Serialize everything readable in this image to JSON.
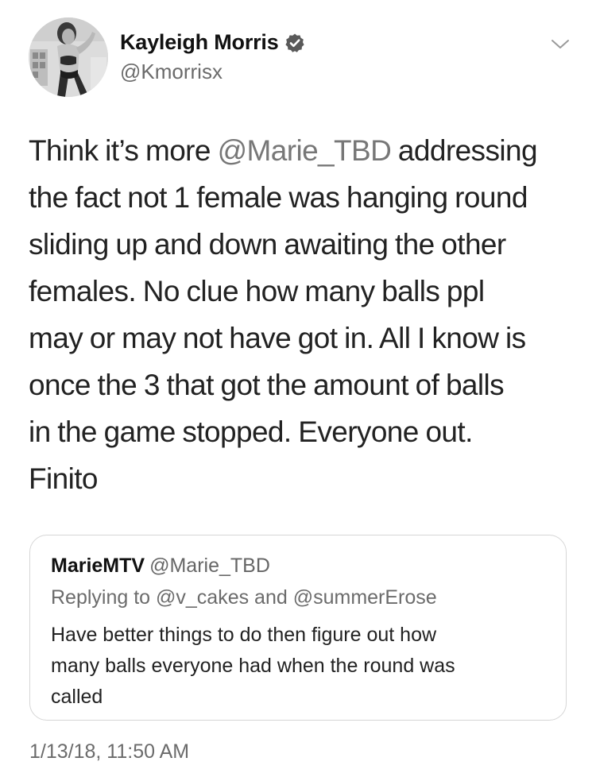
{
  "author": {
    "display_name": "Kayleigh Morris",
    "handle": "@Kmorrisx",
    "verified": true,
    "avatar_icon": "profile-photo-icon"
  },
  "menu": {
    "icon": "chevron-down-icon"
  },
  "tweet": {
    "lines": [
      {
        "pre": "Think it’s more ",
        "mention": "@Marie_TBD",
        "post": " addressing"
      },
      {
        "text": "the fact not 1 female was hanging round"
      },
      {
        "text": "sliding up and down awaiting the other"
      },
      {
        "text": "females. No clue how many balls ppl"
      },
      {
        "text": "may or may not have got in. All I know is"
      },
      {
        "text": "once the 3 that got the amount of balls"
      },
      {
        "text": "in the game stopped. Everyone out."
      },
      {
        "text": "Finito"
      }
    ]
  },
  "quoted_tweet": {
    "display_name": "MarieMTV",
    "handle": "@Marie_TBD",
    "replying_to": "Replying to @v_cakes and @summerErose",
    "lines": [
      "Have better things to do then figure out how",
      "many balls everyone had when the round was",
      "called"
    ]
  },
  "timestamp": "1/13/18, 11:50 AM",
  "colors": {
    "text": "#222222",
    "secondary": "#6b6b6b",
    "border": "#d6d6d6"
  }
}
